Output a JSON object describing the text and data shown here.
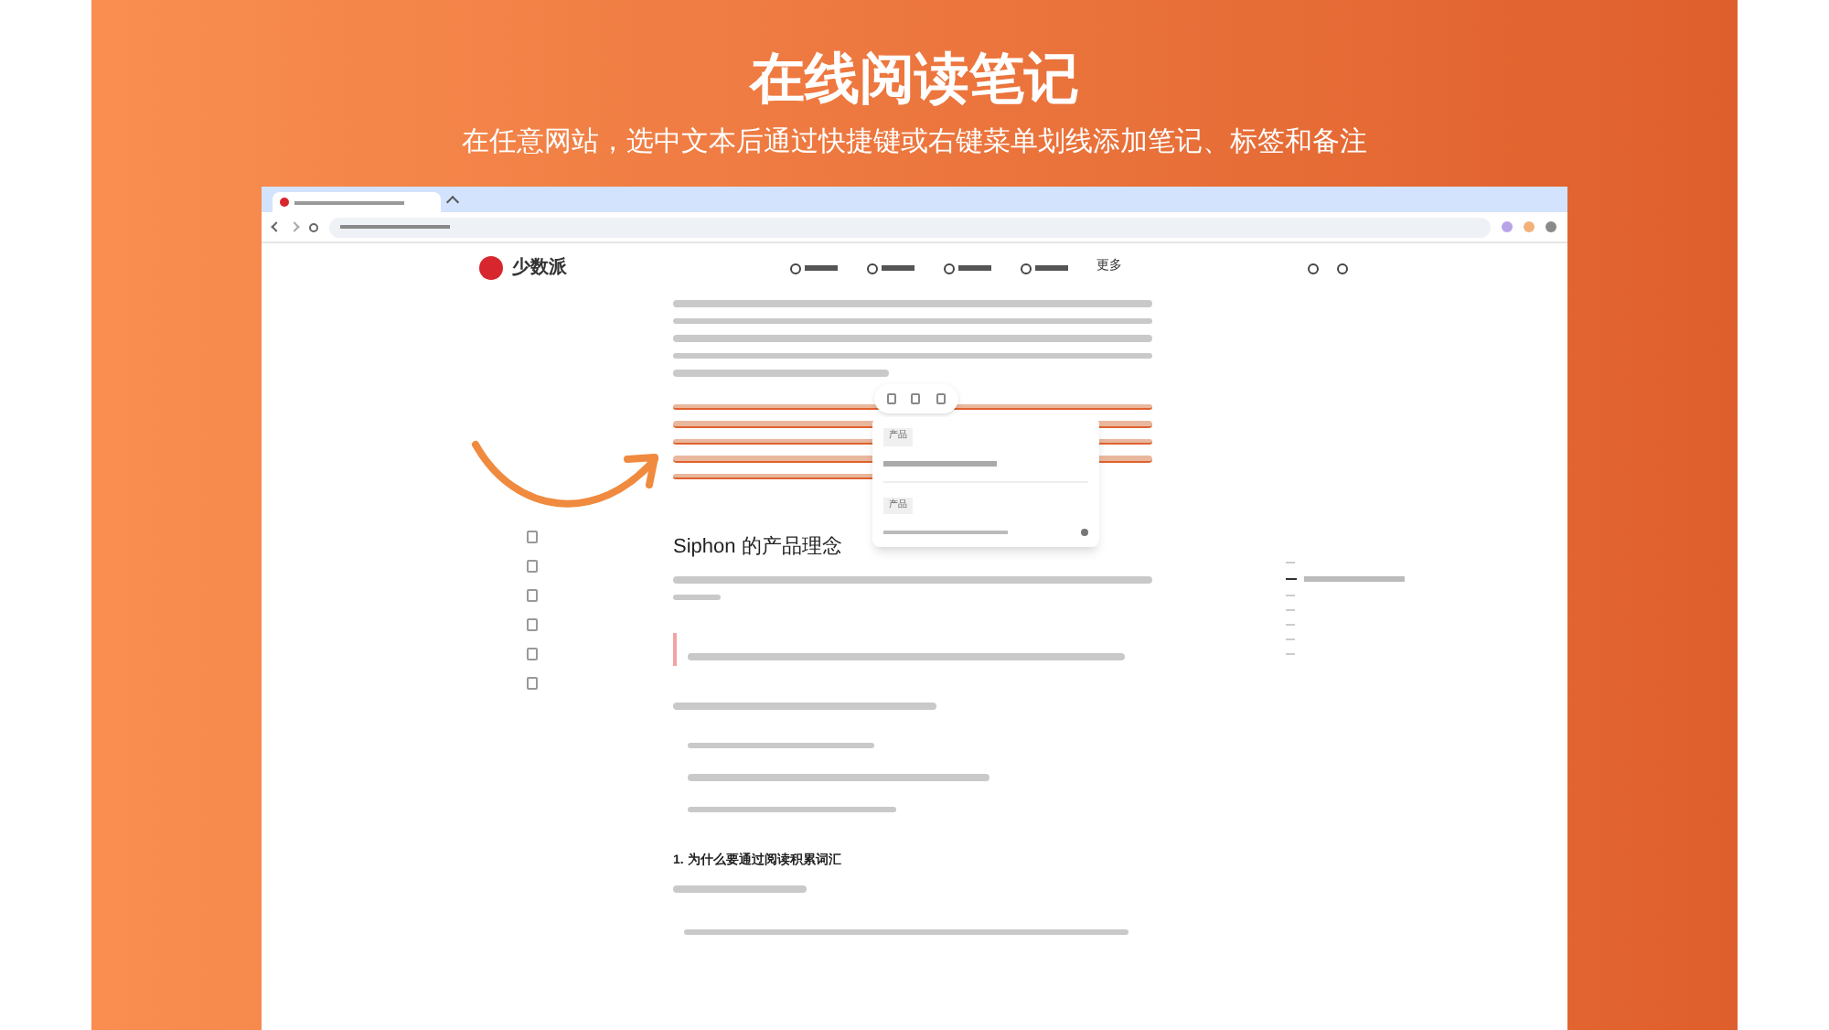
{
  "banner": {
    "title": "在线阅读笔记",
    "subtitle": "在任意网站，选中文本后通过快捷键或右键菜单划线添加笔记、标签和备注"
  },
  "site": {
    "logo_text": "少数派",
    "more_label": "更多"
  },
  "article": {
    "section_heading": "Siphon 的产品理念",
    "subheading": "1. 为什么要通过阅读积累词汇"
  },
  "note_popup": {
    "tags": [
      "产品",
      "产品"
    ]
  }
}
